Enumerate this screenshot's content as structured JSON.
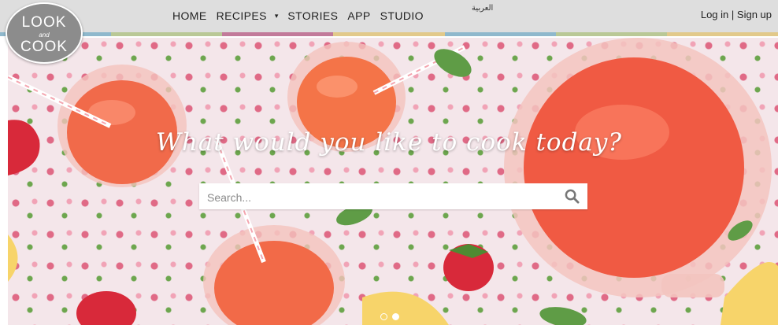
{
  "logo": {
    "line1": "LOOK",
    "line2": "and",
    "line3": "COOK"
  },
  "nav": {
    "home": "HOME",
    "recipes": "RECIPES",
    "recipes_caret": "▾",
    "stories": "STORIES",
    "app": "APP",
    "studio": "STUDIO"
  },
  "language": "العربية",
  "auth": {
    "login": "Log in",
    "separator": "|",
    "signup": "Sign up"
  },
  "hero": {
    "headline": "What would you like to cook today?",
    "search": {
      "placeholder": "Search...",
      "value": ""
    }
  },
  "carousel": {
    "slides": 2,
    "active_slide": 2
  },
  "colors": {
    "topbar": "#dedede",
    "stripe": [
      "#8fb8cc",
      "#b9c896",
      "#c27a9a",
      "#e2c98a",
      "#8fb8cc",
      "#b9c896",
      "#e2c98a"
    ],
    "logo": "#8c8c8c",
    "juice": "#f16a4a"
  },
  "icons": {
    "search": "magnifier-icon"
  }
}
